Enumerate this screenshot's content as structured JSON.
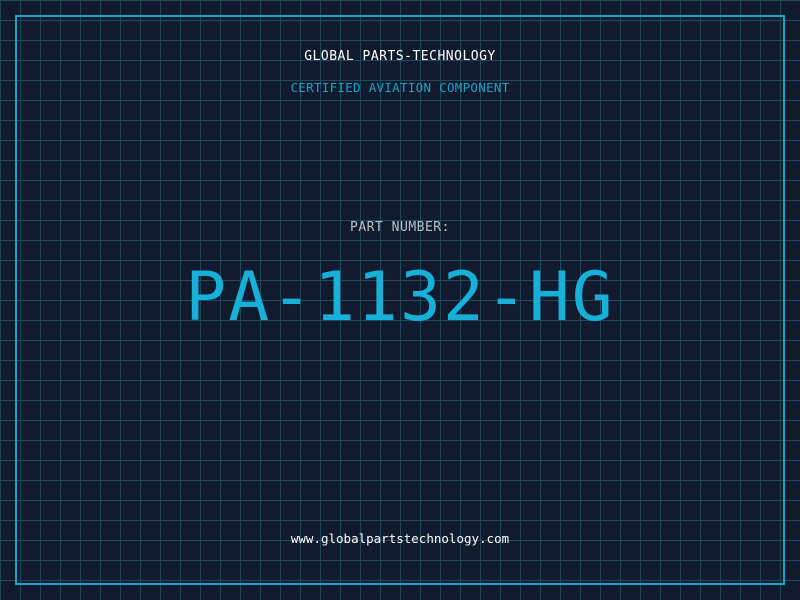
{
  "header": {
    "company": "GLOBAL PARTS-TECHNOLOGY",
    "subtitle": "CERTIFIED AVIATION COMPONENT"
  },
  "main": {
    "label": "PART NUMBER:",
    "part_number": "PA-1132-HG"
  },
  "footer": {
    "url": "www.globalpartstechnology.com"
  },
  "colors": {
    "background": "#121a2e",
    "grid": "#1e4a5e",
    "accent": "#1ba3c9",
    "text": "#ffffff"
  }
}
